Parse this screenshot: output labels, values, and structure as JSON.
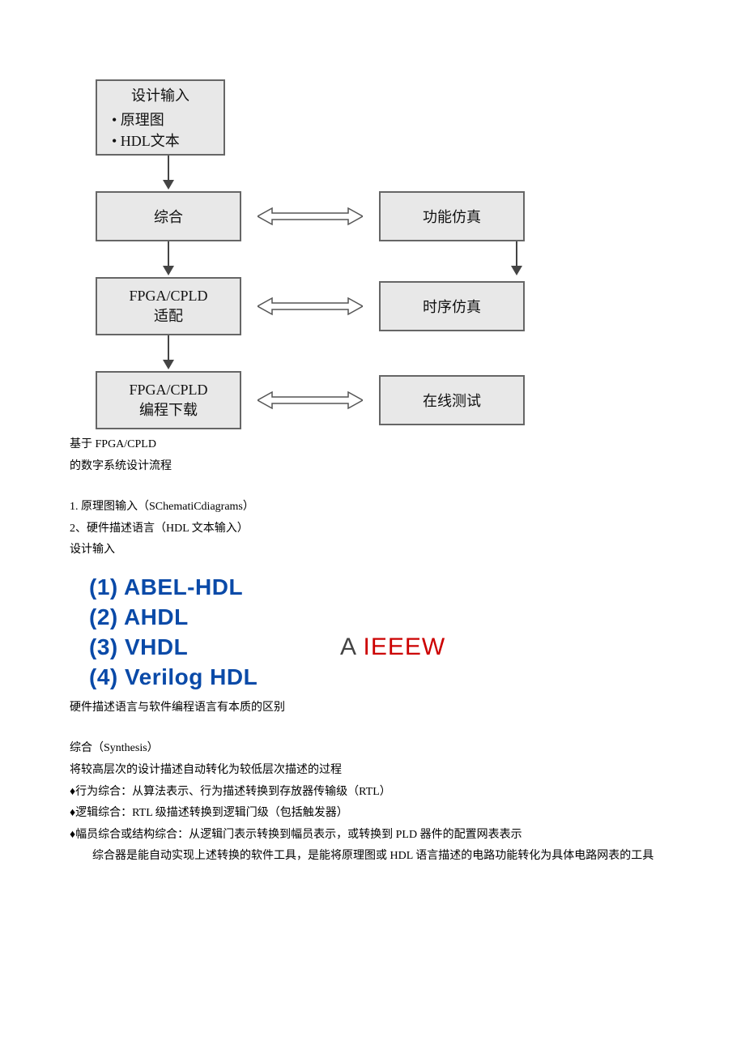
{
  "diagram": {
    "box_top_title": "设计输入",
    "box_top_line1": "• 原理图",
    "box_top_line2": "• HDL文本",
    "box_synth": "综合",
    "box_funcsim": "功能仿真",
    "box_fit_l1": "FPGA/CPLD",
    "box_fit_l2": "适配",
    "box_timesim": "时序仿真",
    "box_prog_l1": "FPGA/CPLD",
    "box_prog_l2": "编程下载",
    "box_online": "在线测试"
  },
  "caption": {
    "l1": "基于 FPGA/CPLD",
    "l2": "的数字系统设计流程"
  },
  "inputs": {
    "l1": "1. 原理图输入（SChematiCdiagrams）",
    "l2": "2、硬件描述语言（HDL 文本输入）",
    "l3": "设计输入"
  },
  "hdl": {
    "i1": "(1)  ABEL-HDL",
    "i2": "(2)  AHDL",
    "i3": "(3)  VHDL",
    "i4": "(4)  Verilog HDL",
    "ieee_a": "A",
    "ieee_w": "IEEEW"
  },
  "note": "硬件描述语言与软件编程语言有本质的区别",
  "synth": {
    "title": "综合（Synthesis）",
    "l1": "将较高层次的设计描述自动转化为较低层次描述的过程",
    "l2": "♦行为综合：从算法表示、行为描述转换到存放器传输级（RTL）",
    "l3": "♦逻辑综合：RTL 级描述转换到逻辑门级（包括触发器）",
    "l4": "♦幅员综合或结构综合：从逻辑门表示转换到幅员表示，或转换到 PLD 器件的配置网表表示",
    "l5": "　　综合器是能自动实现上述转换的软件工具，是能将原理图或 HDL 语言描述的电路功能转化为具体电路网表的工具"
  }
}
